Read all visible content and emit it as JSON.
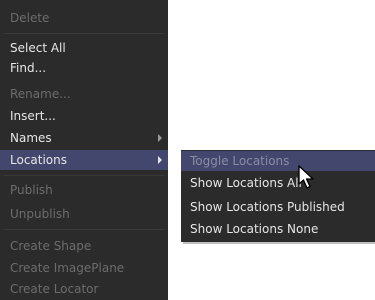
{
  "main_menu": {
    "items": [
      {
        "label": "Delete",
        "enabled": false
      },
      {
        "label": "Select All",
        "enabled": true
      },
      {
        "label": "Find...",
        "enabled": true
      },
      {
        "label": "Rename...",
        "enabled": false
      },
      {
        "label": "Insert...",
        "enabled": true
      },
      {
        "label": "Names",
        "enabled": true,
        "submenu": true
      },
      {
        "label": "Locations",
        "enabled": true,
        "submenu": true,
        "highlighted": true
      },
      {
        "label": "Publish",
        "enabled": false
      },
      {
        "label": "Unpublish",
        "enabled": false
      },
      {
        "label": "Create Shape",
        "enabled": false
      },
      {
        "label": "Create ImagePlane",
        "enabled": false
      },
      {
        "label": "Create Locator",
        "enabled": false
      }
    ]
  },
  "locations_submenu": {
    "items": [
      {
        "label": "Toggle Locations",
        "enabled": false,
        "highlighted": true
      },
      {
        "label": "Show Locations All",
        "enabled": true
      },
      {
        "label": "Show Locations Published",
        "enabled": true
      },
      {
        "label": "Show Locations None",
        "enabled": true
      }
    ]
  },
  "colors": {
    "menu_bg": "#2b2b2b",
    "highlight": "#43476d",
    "text": "#e6e6e6",
    "disabled_text": "#6c6c6c"
  }
}
